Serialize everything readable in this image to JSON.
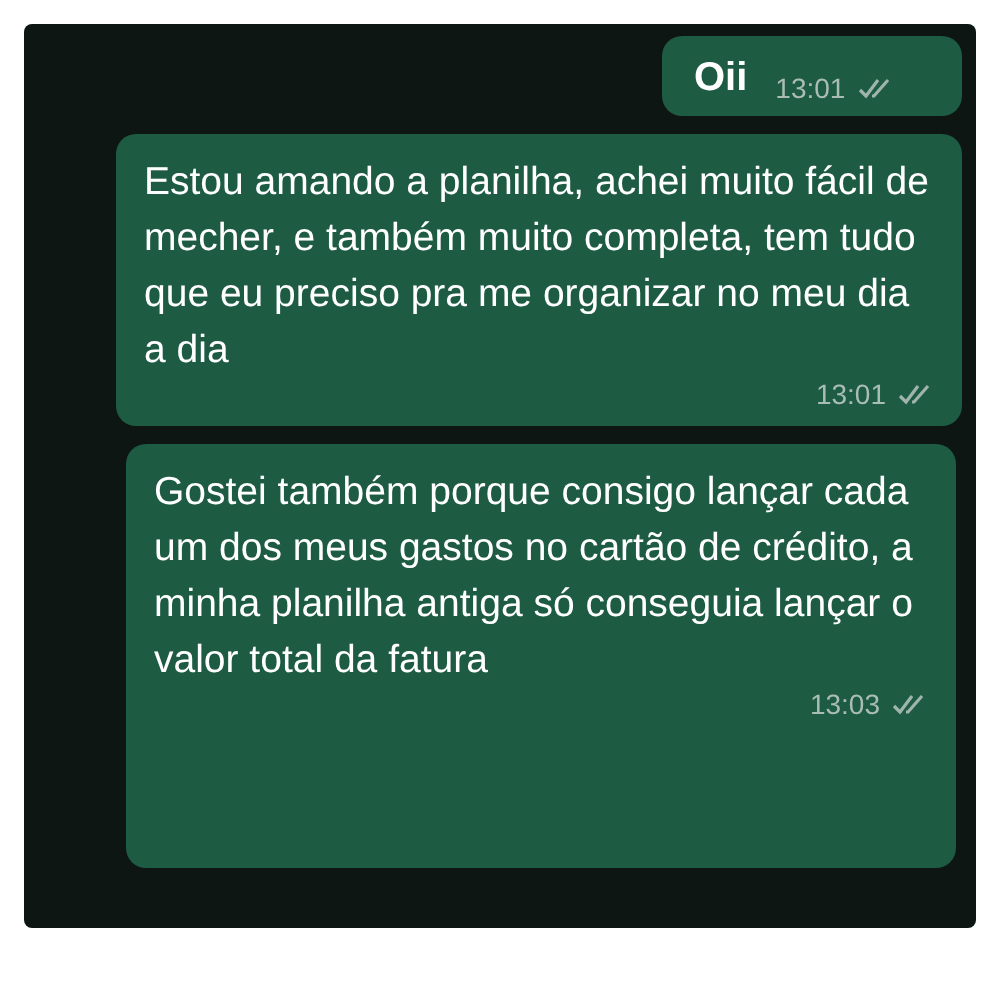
{
  "messages": [
    {
      "text": "Oii",
      "time": "13:01"
    },
    {
      "text": "Estou amando a planilha, achei muito fácil de mecher, e também muito completa, tem tudo que eu preciso pra me organizar no meu dia a dia",
      "time": "13:01"
    },
    {
      "text": "Gostei também porque consigo lançar cada um dos meus gastos no cartão de crédito, a minha planilha antiga só conseguia lançar o valor total da fatura",
      "time": "13:03"
    }
  ]
}
